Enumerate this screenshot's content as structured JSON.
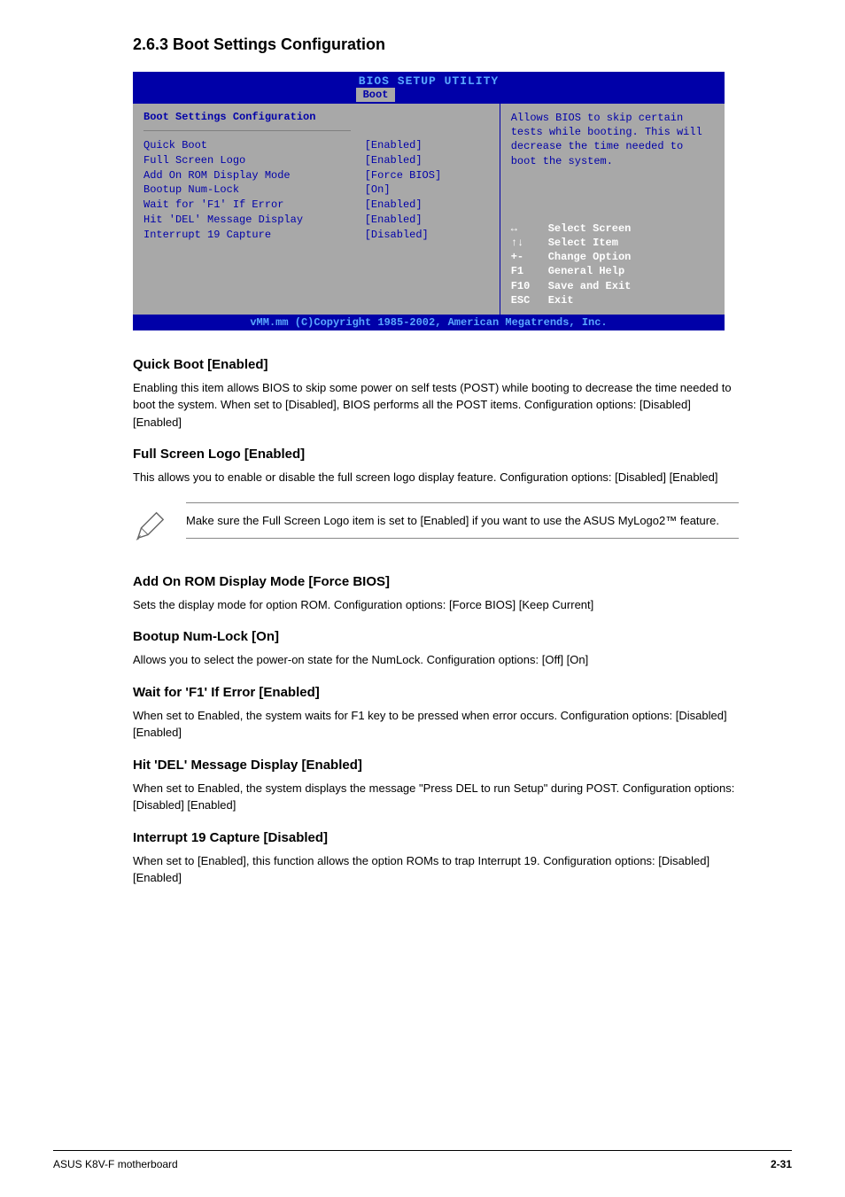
{
  "section_title": "2.6.3 Boot Settings Configuration",
  "bios": {
    "title": "BIOS SETUP UTILITY",
    "tab": "Boot",
    "section_title": "Boot Settings Configuration",
    "settings": [
      {
        "label": "Quick Boot",
        "value": "[Enabled]"
      },
      {
        "label": "Full Screen Logo",
        "value": "[Enabled]"
      },
      {
        "label": "Add On ROM Display Mode",
        "value": "[Force BIOS]"
      },
      {
        "label": "Bootup Num-Lock",
        "value": "[On]"
      },
      {
        "label": "Wait for 'F1' If Error",
        "value": "[Enabled]"
      },
      {
        "label": "Hit 'DEL' Message Display",
        "value": "[Enabled]"
      },
      {
        "label": "Interrupt 19 Capture",
        "value": "[Disabled]"
      }
    ],
    "help_text": "Allows BIOS to skip certain tests while booting. This will decrease the time needed to boot the system.",
    "keys": [
      {
        "icon": "↔",
        "label": "Select Screen"
      },
      {
        "icon": "↑↓",
        "label": "Select Item"
      },
      {
        "icon": "+-",
        "label": "Change Option"
      },
      {
        "icon": "F1",
        "label": "General Help"
      },
      {
        "icon": "F10",
        "label": "Save and Exit"
      },
      {
        "icon": "ESC",
        "label": "Exit"
      }
    ],
    "footer": "vMM.mm (C)Copyright 1985-2002, American Megatrends, Inc."
  },
  "sections": [
    {
      "heading": "Quick Boot [Enabled]",
      "text": "Enabling this item allows BIOS to skip some power on self tests (POST) while booting to decrease the time needed to boot the system. When set to [Disabled], BIOS performs all the POST items. Configuration options: [Disabled] [Enabled]"
    },
    {
      "heading": "Full Screen Logo [Enabled]",
      "text": "This allows you to enable or disable the full screen logo display feature. Configuration options: [Disabled] [Enabled]"
    }
  ],
  "note_text": "Make sure the Full Screen Logo item is set to [Enabled] if you want to use the ASUS MyLogo2™ feature.",
  "sections2": [
    {
      "heading": "Add On ROM Display Mode [Force BIOS]",
      "text": "Sets the display mode for option ROM. Configuration options: [Force BIOS] [Keep Current]"
    },
    {
      "heading": "Bootup Num-Lock [On]",
      "text": "Allows you to select the power-on state for the NumLock. Configuration options: [Off] [On]"
    },
    {
      "heading": "Wait for 'F1' If Error [Enabled]",
      "text": "When set to Enabled, the system waits for F1 key to be pressed when error occurs. Configuration options: [Disabled] [Enabled]"
    },
    {
      "heading": "Hit 'DEL' Message Display [Enabled]",
      "text": "When set to Enabled, the system displays the message \"Press DEL to run Setup\" during POST. Configuration options: [Disabled] [Enabled]"
    },
    {
      "heading": "Interrupt 19 Capture [Disabled]",
      "text": "When set to [Enabled], this function allows the option ROMs to trap Interrupt 19. Configuration options: [Disabled] [Enabled]"
    }
  ],
  "footer": {
    "left": "ASUS K8V-F motherboard",
    "right": "2-31"
  }
}
